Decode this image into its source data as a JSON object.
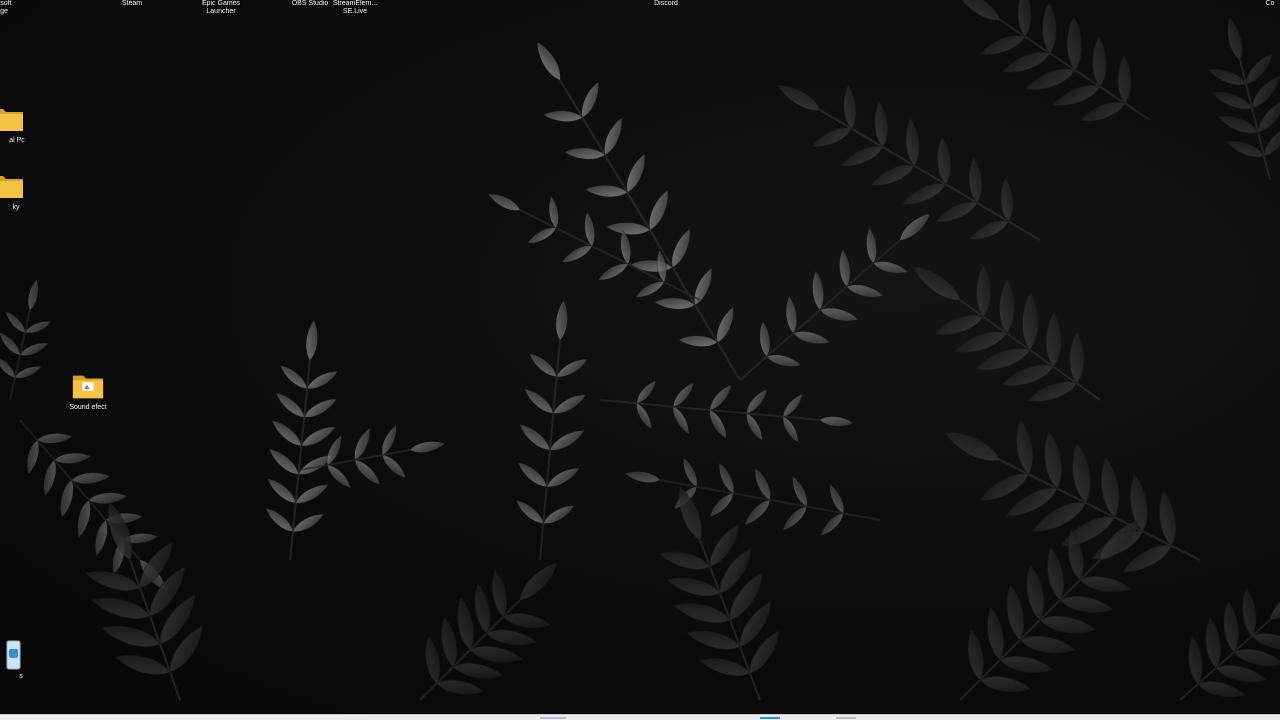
{
  "desktop": {
    "top_icons": [
      {
        "label": "osoft\nge",
        "icon": "edge-icon"
      },
      {
        "label": "Steam",
        "icon": "steam-icon"
      },
      {
        "label": "Epic Games\nLauncher",
        "icon": "epic-games-icon"
      },
      {
        "label": "OBS Studio",
        "icon": "obs-icon"
      },
      {
        "label": "StreamElem...\nSE.Live",
        "icon": "streamelements-icon"
      },
      {
        "label": "Discord",
        "icon": "discord-icon"
      },
      {
        "label": "Co",
        "icon": "app-icon"
      }
    ],
    "left_icons": [
      {
        "label": "al Pc",
        "icon": "folder-icon"
      },
      {
        "label": "ky",
        "icon": "folder-icon"
      },
      {
        "label": "Sound efect",
        "icon": "folder-icon"
      },
      {
        "label": "s",
        "icon": "recycle-bin-icon"
      }
    ]
  },
  "colors": {
    "folder": "#f3c341",
    "folder_dark": "#d9a21f",
    "leaf": "#6b6b6b",
    "taskbar": "#e9ecf1"
  }
}
